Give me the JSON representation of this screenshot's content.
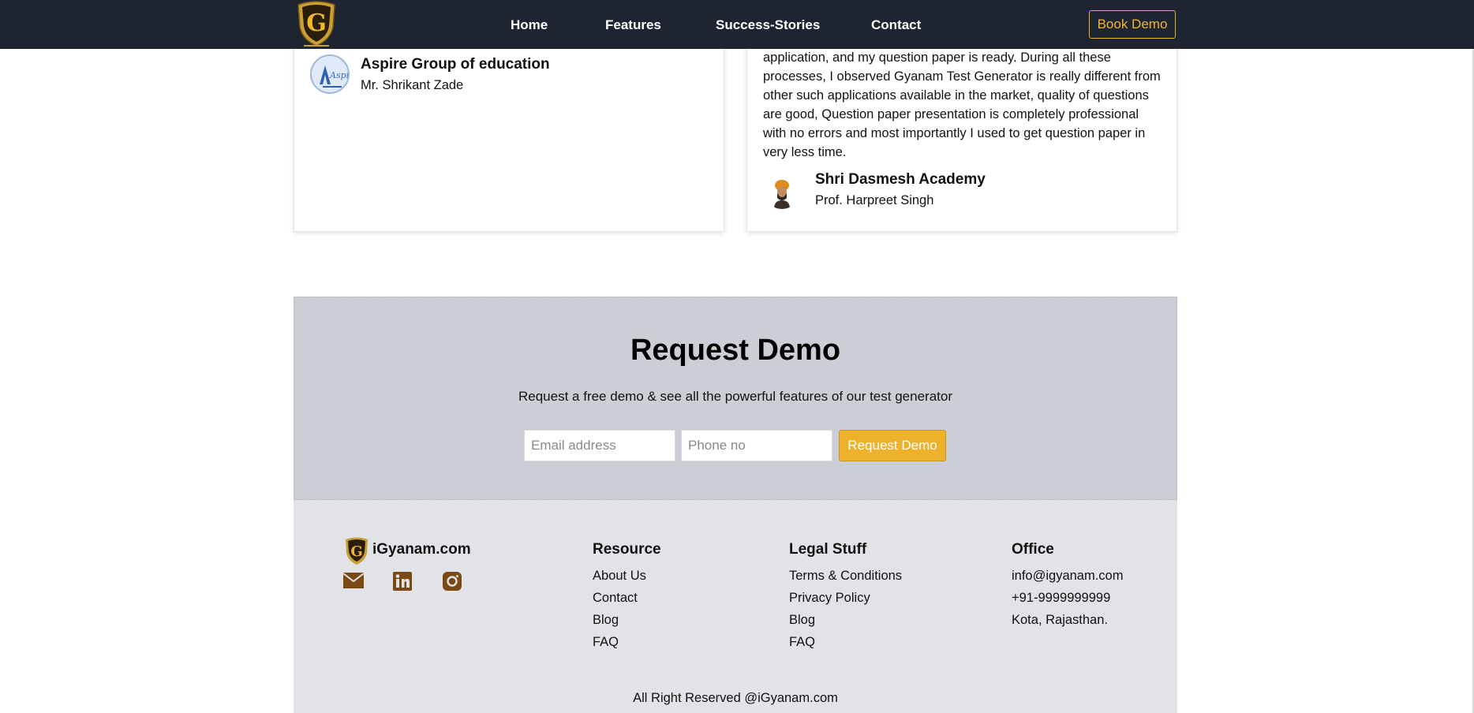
{
  "nav": {
    "links": [
      "Home",
      "Features",
      "Success-Stories",
      "Contact"
    ],
    "book_demo": "Book Demo"
  },
  "testimonials": {
    "left": {
      "org": "Aspire Group of education",
      "person": "Mr. Shrikant Zade"
    },
    "right": {
      "quote": "application, and my question paper is ready. During all these processes, I observed Gyanam Test Generator is really different from other such applications available in the market, quality of questions are good, Question paper presentation is completely professional with no errors and most importantly I used to get question paper in very less time.",
      "org": "Shri Dasmesh Academy",
      "person": "Prof. Harpreet Singh"
    }
  },
  "request_demo": {
    "title": "Request Demo",
    "subtitle": "Request a free demo & see all the powerful features of our test generator",
    "email_placeholder": "Email address",
    "phone_placeholder": "Phone no",
    "button": "Request Demo"
  },
  "footer": {
    "brand": "iGyanam.com",
    "social_icons": [
      "mail-icon",
      "linkedin-icon",
      "instagram-icon"
    ],
    "resource": {
      "title": "Resource",
      "items": [
        "About Us",
        "Contact",
        "Blog",
        "FAQ"
      ]
    },
    "legal": {
      "title": "Legal Stuff",
      "items": [
        "Terms & Conditions",
        "Privacy Policy",
        "Blog",
        "FAQ"
      ]
    },
    "office": {
      "title": "Office",
      "items": [
        "info@igyanam.com",
        "+91-9999999999",
        "Kota, Rajasthan."
      ]
    },
    "copyright": "All Right Reserved @iGyanam.com"
  },
  "colors": {
    "nav_bg": "#1f2530",
    "accent": "#edb12c",
    "demo_bg": "#cbcfd5",
    "footer_bg": "#e1e3e7",
    "social_icon": "#7a4a16"
  }
}
